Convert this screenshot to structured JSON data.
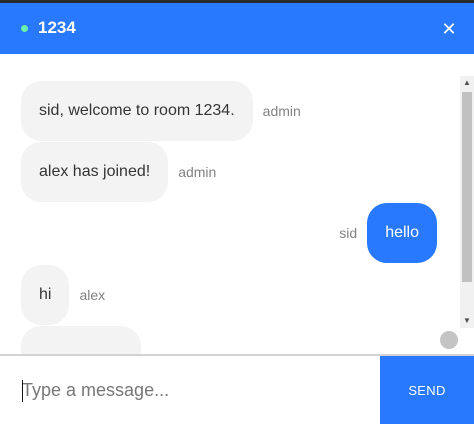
{
  "header": {
    "room_name": "1234",
    "close_label": "✕",
    "status_color": "#69f0ae"
  },
  "theme": {
    "accent": "#2979ff",
    "bubble_other": "#f3f3f3",
    "sender_color": "#828282"
  },
  "messages": [
    {
      "text": "sid, welcome to room 1234.",
      "sender": "admin",
      "mine": false
    },
    {
      "text": "alex has joined!",
      "sender": "admin",
      "mine": false
    },
    {
      "text": "hello",
      "sender": "sid",
      "mine": true
    },
    {
      "text": "hi",
      "sender": "alex",
      "mine": false
    },
    {
      "text": "",
      "sender": "",
      "mine": false
    }
  ],
  "scrollbar": {
    "up_arrow": "▲",
    "down_arrow": "▼"
  },
  "composer": {
    "placeholder": "Type a message...",
    "value": "",
    "send_label": "SEND"
  }
}
